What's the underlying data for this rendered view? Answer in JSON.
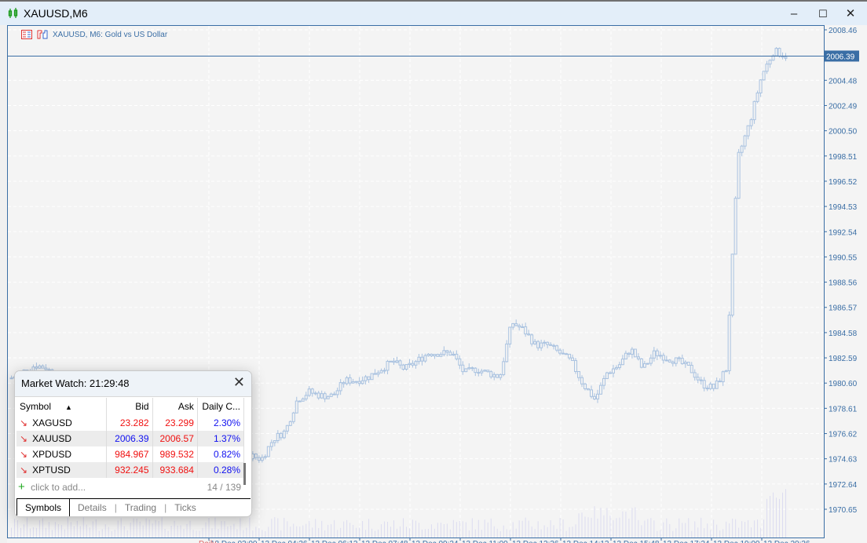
{
  "window": {
    "title": "XAUUSD,M6",
    "minimize": "–",
    "maximize": "☐",
    "close": "✕"
  },
  "chart": {
    "label": "XAUUSD, M6:  Gold vs US Dollar",
    "current_price": "2006.39",
    "period_marker": "Daily",
    "colors": {
      "candle": "#a9c2e0",
      "axis": "#3a6ea5",
      "volume": "#dcdcf0",
      "background": "#f4f4f4"
    }
  },
  "chart_data": {
    "type": "candlestick",
    "symbol": "XAUUSD",
    "timeframe": "M6",
    "y_ticks": [
      "2008.46",
      "2006.39",
      "2004.48",
      "2002.49",
      "2000.50",
      "1998.51",
      "1996.52",
      "1994.53",
      "1992.54",
      "1990.55",
      "1988.56",
      "1986.57",
      "1984.58",
      "1982.59",
      "1980.60",
      "1978.61",
      "1976.62",
      "1974.63",
      "1972.64",
      "1970.65"
    ],
    "ylim": [
      1969.5,
      2009.3
    ],
    "x_ticks": [
      "13 Dec 03:00",
      "13 Dec 04:36",
      "13 Dec 06:12",
      "13 Dec 07:48",
      "13 Dec 09:24",
      "13 Dec 11:00",
      "13 Dec 12:36",
      "13 Dec 14:12",
      "13 Dec 15:48",
      "13 Dec 17:24",
      "13 Dec 19:00",
      "13 Dec 20:36"
    ],
    "approx_close_path": [
      1981.0,
      1981.5,
      1982.0,
      1981.8,
      1980.5,
      1979.5,
      1978.6,
      1979.3,
      1979.9,
      1979.2,
      1978.0,
      1978.1,
      1979.6,
      1979.0,
      1979.6,
      1979.3,
      1978.0,
      1977.1,
      1974.9,
      1974.0,
      1974.9,
      1974.6,
      1976.2,
      1976.8,
      1979.3,
      1979.9,
      1979.6,
      1979.6,
      1980.8,
      1980.8,
      1981.1,
      1981.7,
      1982.3,
      1981.7,
      1982.3,
      1982.96,
      1982.96,
      1982.96,
      1981.4,
      1981.7,
      1981.4,
      1981.1,
      1985.4,
      1984.8,
      1983.6,
      1983.6,
      1983.0,
      1982.3,
      1980.5,
      1979.3,
      1981.4,
      1982.0,
      1983.3,
      1981.7,
      1983.0,
      1982.6,
      1982.3,
      1981.7,
      1980.5,
      1980.2,
      1981.7,
      1998.4,
      2001.2,
      2004.9,
      2006.8,
      2006.39
    ],
    "volume_note": ""
  },
  "market_watch": {
    "title": "Market Watch: 21:29:48",
    "columns": [
      "Symbol",
      "Bid",
      "Ask",
      "Daily C..."
    ],
    "rows": [
      {
        "symbol": "XAGUSD",
        "bid": "23.282",
        "ask": "23.299",
        "daily": "2.30%"
      },
      {
        "symbol": "XAUUSD",
        "bid": "2006.39",
        "ask": "2006.57",
        "daily": "1.37%"
      },
      {
        "symbol": "XPDUSD",
        "bid": "984.967",
        "ask": "989.532",
        "daily": "0.82%"
      },
      {
        "symbol": "XPTUSD",
        "bid": "932.245",
        "ask": "933.684",
        "daily": "0.28%"
      }
    ],
    "add_label": "click to add...",
    "count": "14 / 139",
    "tabs": [
      "Symbols",
      "Details",
      "Trading",
      "Ticks"
    ]
  }
}
